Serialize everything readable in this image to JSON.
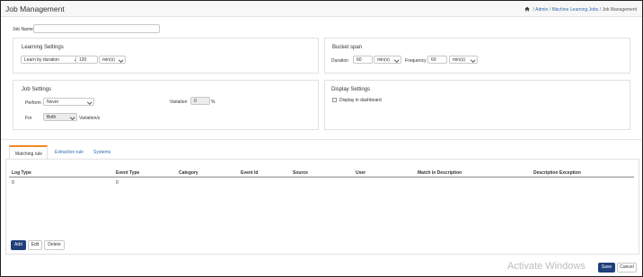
{
  "header": {
    "title": "Job Management",
    "breadcrumb": [
      "Admin",
      "Machine Learning Jobs",
      "Job Management"
    ],
    "separator": "/"
  },
  "job_name": {
    "label": "Job Name",
    "value": ""
  },
  "learning_settings": {
    "title": "Learning Settings",
    "mode": "Learn by duration",
    "amount": "120",
    "unit": "min(s)"
  },
  "bucket_span": {
    "title": "Bucket span",
    "duration_label": "Duration",
    "duration_value": "60",
    "duration_unit": "min(s)",
    "frequency_label": "Frequency",
    "frequency_value": "60",
    "frequency_unit": "min(s)"
  },
  "job_settings": {
    "title": "Job Settings",
    "perform_label": "Perform",
    "perform_value": "Never",
    "variation_label": "Variation",
    "variation_value": "0",
    "variation_unit": "%",
    "for_label": "For",
    "for_value": "Both",
    "for_suffix": "Variation/s"
  },
  "display_settings": {
    "title": "Display Settings",
    "dashboard_label": "Display in dashboard",
    "dashboard_checked": false
  },
  "tabs": [
    {
      "label": "Matching rule",
      "active": true
    },
    {
      "label": "Extraction rule",
      "active": false
    },
    {
      "label": "Systems",
      "active": false
    }
  ],
  "table": {
    "columns": [
      "Log Type",
      "Event Type",
      "Category",
      "Event Id",
      "Source",
      "User",
      "Match in Description",
      "Description Exception"
    ],
    "rows": [
      [
        "0",
        "0",
        "",
        "",
        "",
        "",
        "",
        ""
      ]
    ]
  },
  "actions": {
    "add": "Add",
    "edit": "Edit",
    "delete": "Delete"
  },
  "footer": {
    "save": "Save",
    "cancel": "Cancel"
  },
  "watermark": "Activate Windows",
  "colors": {
    "primary": "#1f3f7a",
    "link": "#2f6bb0",
    "tab_accent": "#f08a24"
  }
}
